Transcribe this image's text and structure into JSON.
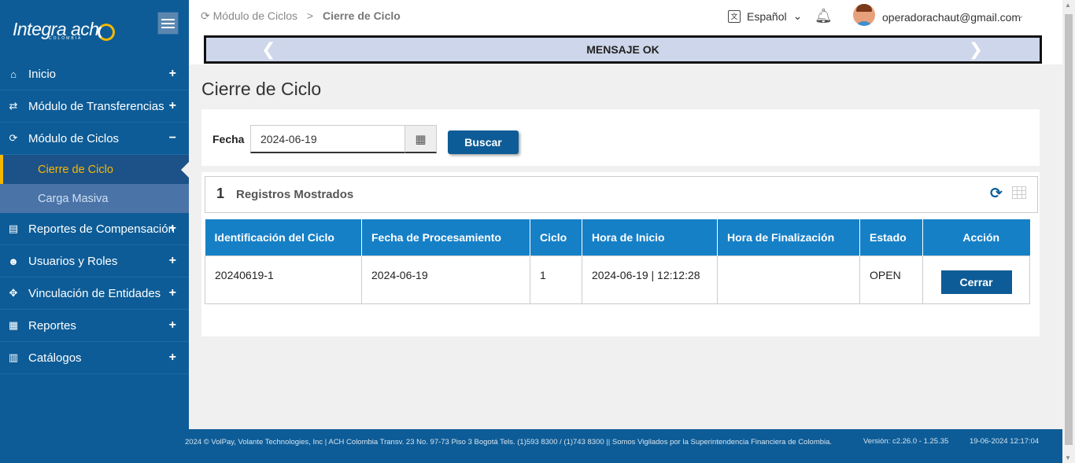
{
  "sidebar": {
    "logo_text": "Integra ach",
    "logo_sub": "COLOMBIA",
    "items": [
      {
        "label": "Inicio",
        "icon": "home-icon",
        "toggle": "+"
      },
      {
        "label": "Módulo de Transferencias",
        "icon": "transfer-icon",
        "toggle": "+"
      },
      {
        "label": "Módulo de Ciclos",
        "icon": "refresh-icon",
        "toggle": "−"
      },
      {
        "label": "Reportes de Compensación",
        "icon": "file-icon",
        "toggle": "+"
      },
      {
        "label": "Usuarios y Roles",
        "icon": "users-icon",
        "toggle": "+"
      },
      {
        "label": "Vinculación de Entidades",
        "icon": "crosshair-icon",
        "toggle": "+"
      },
      {
        "label": "Reportes",
        "icon": "list-icon",
        "toggle": "+"
      },
      {
        "label": "Catálogos",
        "icon": "book-icon",
        "toggle": "+"
      }
    ],
    "sub_items": [
      {
        "label": "Cierre de Ciclo"
      },
      {
        "label": "Carga Masiva"
      }
    ]
  },
  "header": {
    "breadcrumb_parent": "Módulo de Ciclos",
    "breadcrumb_separator": ">",
    "breadcrumb_current": "Cierre de Ciclo",
    "language": "Español",
    "user_email": "operadorachaut@gmail.com"
  },
  "message": {
    "text": "MENSAJE OK"
  },
  "page": {
    "title": "Cierre de Ciclo"
  },
  "filter": {
    "date_label": "Fecha",
    "date_value": "2024-06-19",
    "search_button": "Buscar"
  },
  "results": {
    "count": "1",
    "count_label": "Registros Mostrados",
    "columns": [
      "Identificación del Ciclo",
      "Fecha de Procesamiento",
      "Ciclo",
      "Hora de Inicio",
      "Hora de Finalización",
      "Estado",
      "Acción"
    ],
    "rows": [
      {
        "id": "20240619-1",
        "fecha": "2024-06-19",
        "ciclo": "1",
        "inicio": "2024-06-19 | 12:12:28",
        "fin": "",
        "estado": "OPEN",
        "accion": "Cerrar"
      }
    ]
  },
  "footer": {
    "copyright": "2024 © VolPay, Volante Technologies, Inc | ACH Colombia Transv. 23 No. 97-73 Piso 3 Bogotá Tels. (1)593 8300 / (1)743 8300 || Somos Vigilados por la Superintendencia Financiera de Colombia.",
    "version": "Versión: c2.26.0 - 1.25.35",
    "timestamp": "19-06-2024 12:17:04"
  },
  "colors": {
    "sidebar": "#0d5c97",
    "accent": "#f5b800",
    "table_header": "#1680c7"
  }
}
